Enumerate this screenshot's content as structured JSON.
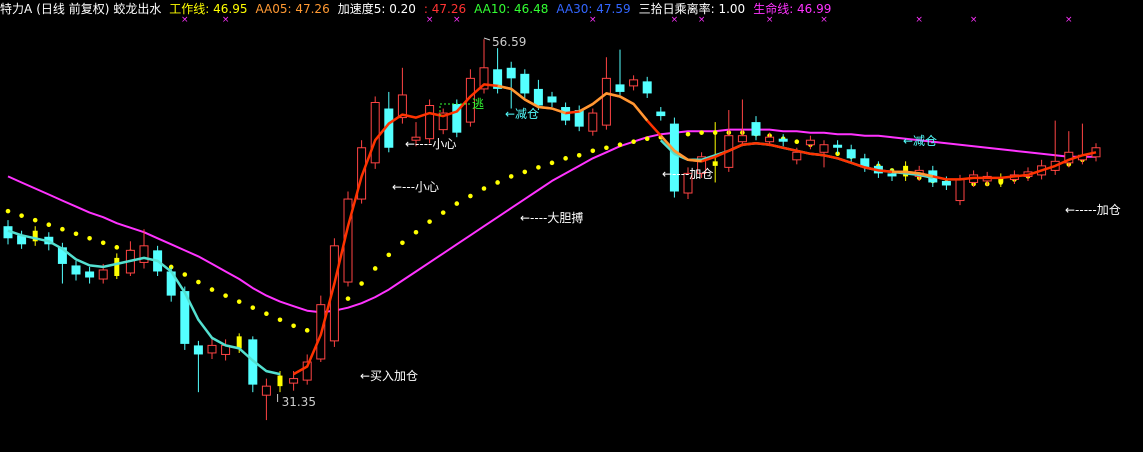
{
  "header": {
    "stock": "特力A",
    "period": "(日线 前复权)",
    "indicator": "蛟龙出水",
    "items": [
      {
        "label": "工作线:",
        "value": "46.95",
        "color": "#ffff00"
      },
      {
        "label": "AA05:",
        "value": "47.26",
        "color": "#ff9933"
      },
      {
        "label": "加速度5:",
        "value": "0.20",
        "color": "#ffffff"
      },
      {
        "label": ":",
        "value": "47.26",
        "color": "#ff3333"
      },
      {
        "label": "AA10:",
        "value": "46.48",
        "color": "#33ff33"
      },
      {
        "label": "AA30:",
        "value": "47.59",
        "color": "#3366ff"
      },
      {
        "label": "三拾日乘离率:",
        "value": "1.00",
        "color": "#ffffff"
      },
      {
        "label": "生命线:",
        "value": "46.99",
        "color": "#ff33ff"
      }
    ]
  },
  "annotations": {
    "high_price": "56.59",
    "low_price": "31.35",
    "escape": "逃",
    "reduce_1": "←减仓",
    "reduce_2": "←减仓",
    "careful_1": "←----小心",
    "careful_2": "←---小心",
    "bold": "←----大胆搏",
    "add_1": "←----加仓",
    "add_2": "←-----加仓",
    "buy_add": "←买入加仓"
  },
  "colors": {
    "up": "#ff4444",
    "down": "#54ffff",
    "special": "#ffff00",
    "work_line": "#ff3300",
    "aa05": "#ff9933",
    "trend": "#54e0d0",
    "life": "#ff33ff",
    "dots": "#ffff00",
    "marker": "#ff33ff"
  },
  "chart_data": {
    "type": "candlestick",
    "ylim": [
      29.5,
      58.0
    ],
    "candles": [
      {
        "o": 44.2,
        "c": 43.4,
        "h": 44.6,
        "l": 43.0
      },
      {
        "o": 43.6,
        "c": 43.0,
        "h": 43.9,
        "l": 42.7
      },
      {
        "o": 43.2,
        "c": 43.9,
        "h": 44.2,
        "l": 42.9,
        "s": 1
      },
      {
        "o": 43.5,
        "c": 43.0,
        "h": 43.8,
        "l": 42.6
      },
      {
        "o": 42.8,
        "c": 41.7,
        "h": 43.1,
        "l": 40.4
      },
      {
        "o": 41.6,
        "c": 41.0,
        "h": 41.9,
        "l": 40.6
      },
      {
        "o": 41.2,
        "c": 40.8,
        "h": 41.5,
        "l": 40.4
      },
      {
        "o": 40.7,
        "c": 41.3,
        "h": 41.7,
        "l": 40.4
      },
      {
        "o": 40.9,
        "c": 42.1,
        "h": 42.4,
        "l": 40.7,
        "s": 1
      },
      {
        "o": 41.1,
        "c": 42.6,
        "h": 43.2,
        "l": 40.9
      },
      {
        "o": 41.8,
        "c": 42.9,
        "h": 44.0,
        "l": 41.4
      },
      {
        "o": 42.6,
        "c": 41.2,
        "h": 42.9,
        "l": 40.9
      },
      {
        "o": 41.2,
        "c": 39.6,
        "h": 41.5,
        "l": 39.2
      },
      {
        "o": 39.9,
        "c": 36.4,
        "h": 40.2,
        "l": 36.0
      },
      {
        "o": 36.3,
        "c": 35.7,
        "h": 36.6,
        "l": 33.2
      },
      {
        "o": 35.8,
        "c": 36.3,
        "h": 36.9,
        "l": 35.4
      },
      {
        "o": 35.7,
        "c": 36.3,
        "h": 36.7,
        "l": 35.3
      },
      {
        "o": 36.1,
        "c": 36.9,
        "h": 37.1,
        "l": 35.8,
        "s": 1
      },
      {
        "o": 36.7,
        "c": 33.7,
        "h": 36.9,
        "l": 33.2
      },
      {
        "o": 33.0,
        "c": 33.6,
        "h": 34.1,
        "l": 31.35
      },
      {
        "o": 33.6,
        "c": 34.3,
        "h": 34.6,
        "l": 33.2,
        "s": 1
      },
      {
        "o": 33.8,
        "c": 34.1,
        "h": 34.6,
        "l": 33.3
      },
      {
        "o": 34.0,
        "c": 35.2,
        "h": 35.7,
        "l": 33.7
      },
      {
        "o": 35.4,
        "c": 39.0,
        "h": 39.6,
        "l": 35.2
      },
      {
        "o": 36.6,
        "c": 42.9,
        "h": 43.4,
        "l": 36.2
      },
      {
        "o": 40.5,
        "c": 46.0,
        "h": 46.5,
        "l": 40.2
      },
      {
        "o": 46.0,
        "c": 49.4,
        "h": 49.9,
        "l": 45.7
      },
      {
        "o": 48.4,
        "c": 52.4,
        "h": 52.8,
        "l": 48.0
      },
      {
        "o": 52.0,
        "c": 49.4,
        "h": 53.1,
        "l": 49.1
      },
      {
        "o": 51.4,
        "c": 52.9,
        "h": 54.7,
        "l": 51.0
      },
      {
        "o": 49.9,
        "c": 50.1,
        "h": 51.1,
        "l": 49.5
      },
      {
        "o": 50.0,
        "c": 52.2,
        "h": 52.6,
        "l": 49.7
      },
      {
        "o": 50.6,
        "c": 51.7,
        "h": 52.0,
        "l": 50.3
      },
      {
        "o": 52.3,
        "c": 50.4,
        "h": 52.6,
        "l": 50.1
      },
      {
        "o": 51.1,
        "c": 54.0,
        "h": 54.6,
        "l": 50.8
      },
      {
        "o": 53.3,
        "c": 54.7,
        "h": 56.59,
        "l": 53.0
      },
      {
        "o": 54.6,
        "c": 53.3,
        "h": 56.0,
        "l": 53.0
      },
      {
        "o": 54.7,
        "c": 54.0,
        "h": 55.1,
        "l": 52.0
      },
      {
        "o": 54.3,
        "c": 53.0,
        "h": 54.6,
        "l": 52.7
      },
      {
        "o": 53.3,
        "c": 52.2,
        "h": 53.9,
        "l": 51.9
      },
      {
        "o": 52.8,
        "c": 52.4,
        "h": 53.1,
        "l": 52.1
      },
      {
        "o": 52.1,
        "c": 51.2,
        "h": 52.4,
        "l": 50.9
      },
      {
        "o": 51.9,
        "c": 50.8,
        "h": 52.2,
        "l": 50.5
      },
      {
        "o": 50.5,
        "c": 51.7,
        "h": 52.0,
        "l": 50.2
      },
      {
        "o": 50.9,
        "c": 54.0,
        "h": 55.4,
        "l": 50.6
      },
      {
        "o": 53.6,
        "c": 53.1,
        "h": 55.9,
        "l": 52.7
      },
      {
        "o": 53.5,
        "c": 53.9,
        "h": 54.2,
        "l": 53.2
      },
      {
        "o": 53.8,
        "c": 53.0,
        "h": 54.1,
        "l": 52.7
      },
      {
        "o": 51.8,
        "c": 51.5,
        "h": 52.1,
        "l": 51.2
      },
      {
        "o": 51.0,
        "c": 46.5,
        "h": 51.4,
        "l": 46.1
      },
      {
        "o": 46.4,
        "c": 47.7,
        "h": 48.1,
        "l": 46.0
      },
      {
        "o": 47.7,
        "c": 48.8,
        "h": 49.1,
        "l": 47.4
      },
      {
        "o": 48.2,
        "c": 48.5,
        "h": 51.1,
        "l": 47.1,
        "s": 1
      },
      {
        "o": 48.1,
        "c": 50.2,
        "h": 51.9,
        "l": 47.8
      },
      {
        "o": 49.8,
        "c": 50.2,
        "h": 52.6,
        "l": 49.5
      },
      {
        "o": 51.1,
        "c": 50.2,
        "h": 51.5,
        "l": 49.9
      },
      {
        "o": 49.8,
        "c": 50.1,
        "h": 50.4,
        "l": 49.5
      },
      {
        "o": 50.0,
        "c": 49.8,
        "h": 50.3,
        "l": 49.5
      },
      {
        "o": 48.6,
        "c": 49.1,
        "h": 49.4,
        "l": 48.3
      },
      {
        "o": 49.6,
        "c": 49.9,
        "h": 50.2,
        "l": 49.3
      },
      {
        "o": 49.1,
        "c": 49.6,
        "h": 49.9,
        "l": 48.1
      },
      {
        "o": 49.6,
        "c": 49.4,
        "h": 49.9,
        "l": 49.0
      },
      {
        "o": 49.3,
        "c": 48.7,
        "h": 49.6,
        "l": 48.4
      },
      {
        "o": 48.7,
        "c": 48.1,
        "h": 49.0,
        "l": 47.8
      },
      {
        "o": 48.2,
        "c": 47.7,
        "h": 48.5,
        "l": 47.4
      },
      {
        "o": 47.7,
        "c": 47.5,
        "h": 48.0,
        "l": 47.2
      },
      {
        "o": 47.5,
        "c": 48.2,
        "h": 48.5,
        "l": 47.2,
        "s": 1
      },
      {
        "o": 47.5,
        "c": 47.9,
        "h": 48.2,
        "l": 47.2
      },
      {
        "o": 47.9,
        "c": 47.1,
        "h": 48.2,
        "l": 46.8
      },
      {
        "o": 47.2,
        "c": 46.9,
        "h": 47.5,
        "l": 46.6
      },
      {
        "o": 45.9,
        "c": 47.3,
        "h": 47.6,
        "l": 45.6
      },
      {
        "o": 47.1,
        "c": 47.6,
        "h": 47.9,
        "l": 46.8
      },
      {
        "o": 47.2,
        "c": 47.5,
        "h": 47.8,
        "l": 46.9
      },
      {
        "o": 47.1,
        "c": 47.4,
        "h": 47.7,
        "l": 46.8,
        "s": 1
      },
      {
        "o": 47.3,
        "c": 47.6,
        "h": 47.9,
        "l": 47.0
      },
      {
        "o": 47.5,
        "c": 47.8,
        "h": 48.1,
        "l": 47.2
      },
      {
        "o": 47.6,
        "c": 48.2,
        "h": 48.6,
        "l": 47.3
      },
      {
        "o": 47.9,
        "c": 48.5,
        "h": 51.2,
        "l": 47.6
      },
      {
        "o": 48.4,
        "c": 49.1,
        "h": 50.5,
        "l": 48.1
      },
      {
        "o": 48.6,
        "c": 48.9,
        "h": 51.0,
        "l": 48.3
      },
      {
        "o": 48.8,
        "c": 49.4,
        "h": 49.7,
        "l": 48.5
      }
    ],
    "work_line": [
      null,
      null,
      null,
      null,
      null,
      null,
      null,
      null,
      null,
      null,
      null,
      null,
      null,
      null,
      null,
      null,
      null,
      null,
      null,
      null,
      null,
      34.4,
      34.9,
      37.0,
      40.4,
      44.2,
      47.5,
      49.9,
      51.0,
      51.6,
      51.4,
      51.7,
      51.5,
      51.8,
      52.8,
      53.6,
      53.5,
      53.3,
      52.6,
      52.1,
      52.0,
      51.7,
      51.8,
      52.3,
      53.0,
      52.8,
      52.3,
      51.2,
      50.2,
      49.2,
      48.6,
      48.5,
      48.8,
      49.2,
      49.6,
      49.7,
      49.6,
      49.4,
      49.2,
      49.0,
      48.9,
      48.7,
      48.4,
      48.1,
      47.9,
      47.8,
      47.8,
      47.7,
      47.5,
      47.3,
      47.3,
      47.4,
      47.4,
      47.4,
      47.5,
      47.6,
      47.9,
      48.2,
      48.6,
      48.9,
      49.1
    ],
    "trend_line": [
      43.9,
      43.6,
      43.4,
      43.2,
      42.7,
      42.0,
      41.6,
      41.5,
      41.7,
      41.9,
      42.1,
      41.9,
      41.2,
      39.8,
      38.0,
      36.8,
      36.3,
      36.1,
      35.3,
      34.6,
      34.4,
      null,
      null,
      null,
      null,
      null,
      null,
      null,
      null,
      null,
      null,
      null,
      null,
      null,
      null,
      null,
      null,
      null,
      null,
      null,
      null,
      null,
      null,
      null,
      null,
      null,
      null,
      null,
      49.9,
      49.0,
      48.6,
      48.6,
      48.9,
      49.2,
      49.6,
      49.7,
      49.6,
      49.4,
      49.2,
      49.0,
      48.9,
      48.7,
      48.4,
      48.1,
      47.9,
      47.8,
      47.7,
      47.6,
      47.4,
      null,
      null,
      null,
      null,
      null,
      null,
      null,
      null,
      null,
      null,
      null,
      null
    ],
    "orange_segments": [
      [
        36,
        41
      ],
      [
        42,
        47
      ],
      [
        48,
        51
      ],
      [
        65,
        68
      ]
    ],
    "life_line": [
      47.5,
      47.1,
      46.7,
      46.3,
      45.9,
      45.5,
      45.1,
      44.8,
      44.4,
      44.1,
      43.8,
      43.4,
      43.0,
      42.6,
      42.2,
      41.7,
      41.2,
      40.7,
      40.1,
      39.6,
      39.2,
      38.9,
      38.6,
      38.5,
      38.6,
      38.8,
      39.1,
      39.5,
      40.0,
      40.6,
      41.2,
      41.8,
      42.4,
      43.0,
      43.6,
      44.2,
      44.8,
      45.4,
      46.0,
      46.6,
      47.2,
      47.7,
      48.2,
      48.7,
      49.1,
      49.5,
      49.8,
      50.1,
      50.3,
      50.4,
      50.5,
      50.5,
      50.5,
      50.6,
      50.6,
      50.6,
      50.6,
      50.5,
      50.5,
      50.4,
      50.4,
      50.3,
      50.3,
      50.2,
      50.2,
      50.1,
      50.0,
      49.9,
      49.8,
      49.7,
      49.6,
      49.5,
      49.4,
      49.3,
      49.2,
      49.1,
      49.0,
      48.9,
      48.8,
      48.8,
      48.8
    ],
    "dots": [
      [
        0,
        45.2
      ],
      [
        1,
        44.9
      ],
      [
        2,
        44.6
      ],
      [
        3,
        44.3
      ],
      [
        4,
        44.0
      ],
      [
        5,
        43.7
      ],
      [
        6,
        43.4
      ],
      [
        7,
        43.1
      ],
      [
        8,
        42.8
      ],
      [
        9,
        42.5
      ],
      [
        10,
        42.2
      ],
      [
        11,
        41.9
      ],
      [
        12,
        41.5
      ],
      [
        13,
        41.0
      ],
      [
        14,
        40.5
      ],
      [
        15,
        40.0
      ],
      [
        16,
        39.6
      ],
      [
        17,
        39.2
      ],
      [
        18,
        38.8
      ],
      [
        19,
        38.4
      ],
      [
        20,
        38.0
      ],
      [
        21,
        37.6
      ],
      [
        22,
        37.3
      ],
      [
        23,
        37.6
      ],
      [
        24,
        38.4
      ],
      [
        25,
        39.4
      ],
      [
        26,
        40.4
      ],
      [
        27,
        41.4
      ],
      [
        28,
        42.3
      ],
      [
        29,
        43.1
      ],
      [
        30,
        43.8
      ],
      [
        31,
        44.5
      ],
      [
        32,
        45.1
      ],
      [
        33,
        45.7
      ],
      [
        34,
        46.2
      ],
      [
        35,
        46.7
      ],
      [
        36,
        47.1
      ],
      [
        37,
        47.5
      ],
      [
        38,
        47.8
      ],
      [
        39,
        48.1
      ],
      [
        40,
        48.4
      ],
      [
        41,
        48.7
      ],
      [
        42,
        48.9
      ],
      [
        43,
        49.2
      ],
      [
        44,
        49.4
      ],
      [
        45,
        49.6
      ],
      [
        46,
        49.8
      ],
      [
        47,
        50.0
      ],
      [
        48,
        50.1
      ],
      [
        49,
        50.2
      ],
      [
        50,
        50.3
      ],
      [
        51,
        50.4
      ],
      [
        52,
        50.4
      ],
      [
        53,
        50.4
      ],
      [
        54,
        50.4
      ],
      [
        55,
        50.3
      ],
      [
        56,
        50.2
      ],
      [
        57,
        50.0
      ],
      [
        58,
        49.8
      ],
      [
        59,
        49.6
      ],
      [
        60,
        49.3
      ],
      [
        61,
        49.0
      ],
      [
        62,
        48.8
      ],
      [
        63,
        48.5
      ],
      [
        64,
        48.2
      ],
      [
        65,
        47.9
      ],
      [
        66,
        47.7
      ],
      [
        67,
        47.4
      ],
      [
        68,
        47.2
      ],
      [
        69,
        47.1
      ],
      [
        70,
        47.0
      ],
      [
        71,
        47.0
      ],
      [
        72,
        47.0
      ],
      [
        73,
        47.1
      ],
      [
        74,
        47.3
      ],
      [
        75,
        47.5
      ],
      [
        76,
        47.7
      ],
      [
        77,
        48.0
      ],
      [
        78,
        48.3
      ],
      [
        79,
        48.6
      ]
    ],
    "markers": [
      13,
      16,
      31,
      33,
      43,
      49,
      51,
      56,
      60,
      67,
      71,
      78
    ]
  }
}
